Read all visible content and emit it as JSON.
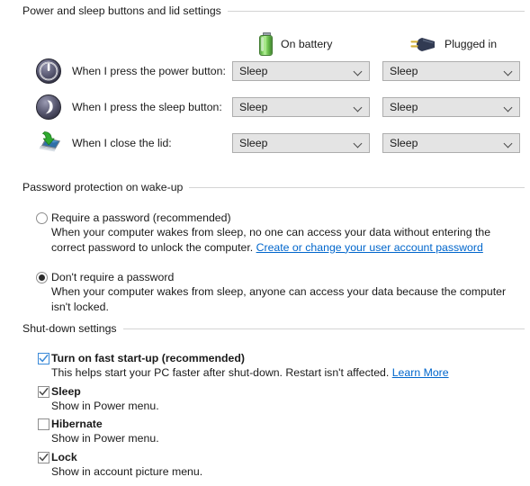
{
  "power_section": {
    "header": "Power and sleep buttons and lid settings",
    "columns": [
      {
        "label": "On battery",
        "icon": "battery-icon"
      },
      {
        "label": "Plugged in",
        "icon": "power-plug-icon"
      }
    ],
    "rows": [
      {
        "icon": "power-button-icon",
        "label": "When I press the power button:",
        "on_battery": "Sleep",
        "plugged_in": "Sleep"
      },
      {
        "icon": "sleep-button-icon",
        "label": "When I press the sleep button:",
        "on_battery": "Sleep",
        "plugged_in": "Sleep"
      },
      {
        "icon": "close-lid-icon",
        "label": "When I close the lid:",
        "on_battery": "Sleep",
        "plugged_in": "Sleep"
      }
    ]
  },
  "password_section": {
    "header": "Password protection on wake-up",
    "options": [
      {
        "title": "Require a password (recommended)",
        "selected": false,
        "desc_before": "When your computer wakes from sleep, no one can access your data without entering the correct password to unlock the computer. ",
        "link": "Create or change your user account password"
      },
      {
        "title": "Don't require a password",
        "selected": true,
        "desc_before": "When your computer wakes from sleep, anyone can access your data because the computer isn't locked.",
        "link": ""
      }
    ]
  },
  "shutdown_section": {
    "header": "Shut-down settings",
    "items": [
      {
        "title": "Turn on fast start-up (recommended)",
        "checked": true,
        "accent": true,
        "desc_before": "This helps start your PC faster after shut-down. Restart isn't affected. ",
        "link": "Learn More"
      },
      {
        "title": "Sleep",
        "checked": true,
        "accent": false,
        "desc_before": "Show in Power menu.",
        "link": ""
      },
      {
        "title": "Hibernate",
        "checked": false,
        "accent": false,
        "desc_before": "Show in Power menu.",
        "link": ""
      },
      {
        "title": "Lock",
        "checked": true,
        "accent": false,
        "desc_before": "Show in account picture menu.",
        "link": ""
      }
    ]
  },
  "colors": {
    "link": "#0066cc",
    "accent_checkbox": "#3b8ad8",
    "battery_green": "#5cb040",
    "combo_background": "#e4e4e4",
    "rule": "#d4d4d4"
  }
}
